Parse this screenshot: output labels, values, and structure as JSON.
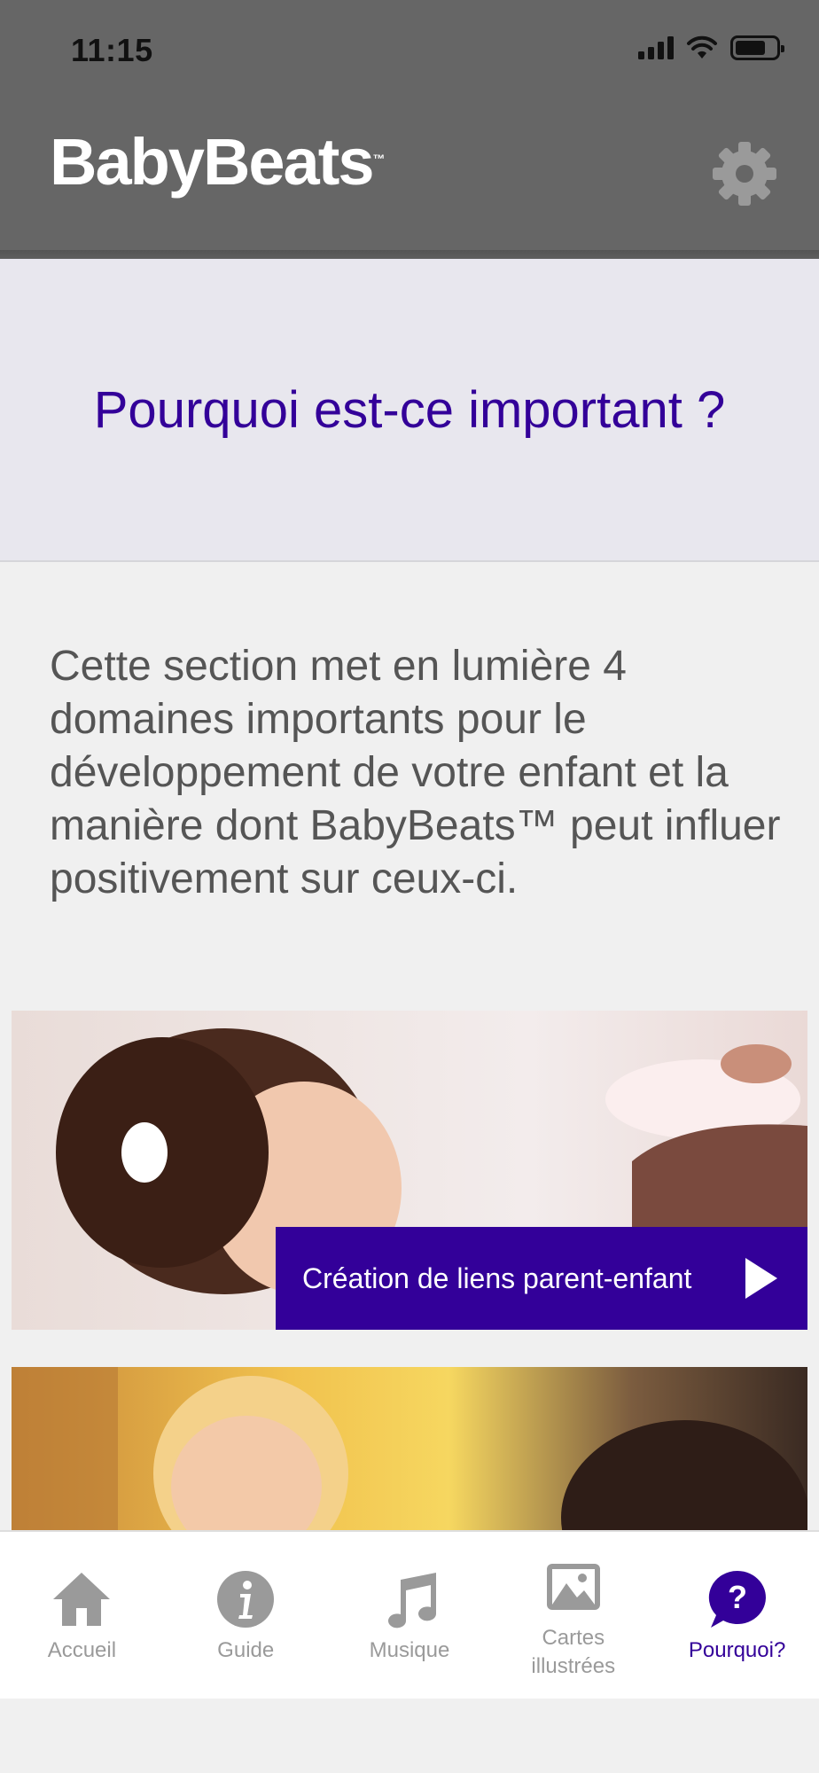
{
  "status_bar": {
    "time": "11:15"
  },
  "header": {
    "logo": "BabyBeats",
    "logo_tm": "™"
  },
  "page_title": "Pourquoi est-ce important ?",
  "intro": "Cette section met en lumière 4 domaines importants pour le développement de votre enfant et la manière dont BabyBeats™ peut influer positivement sur ceux-ci.",
  "cards": [
    {
      "caption": "Création de liens parent-enfant"
    }
  ],
  "tabs": [
    {
      "label": "Accueil",
      "icon": "home-icon"
    },
    {
      "label": "Guide",
      "icon": "info-icon"
    },
    {
      "label": "Musique",
      "icon": "music-note-icon"
    },
    {
      "label": "Cartes illustrées",
      "icon": "picture-icon"
    },
    {
      "label": "Pourquoi?",
      "icon": "question-bubble-icon",
      "active": true
    }
  ],
  "colors": {
    "accent": "#330099",
    "header": "#666666",
    "tab_inactive": "#9a9a9a"
  }
}
